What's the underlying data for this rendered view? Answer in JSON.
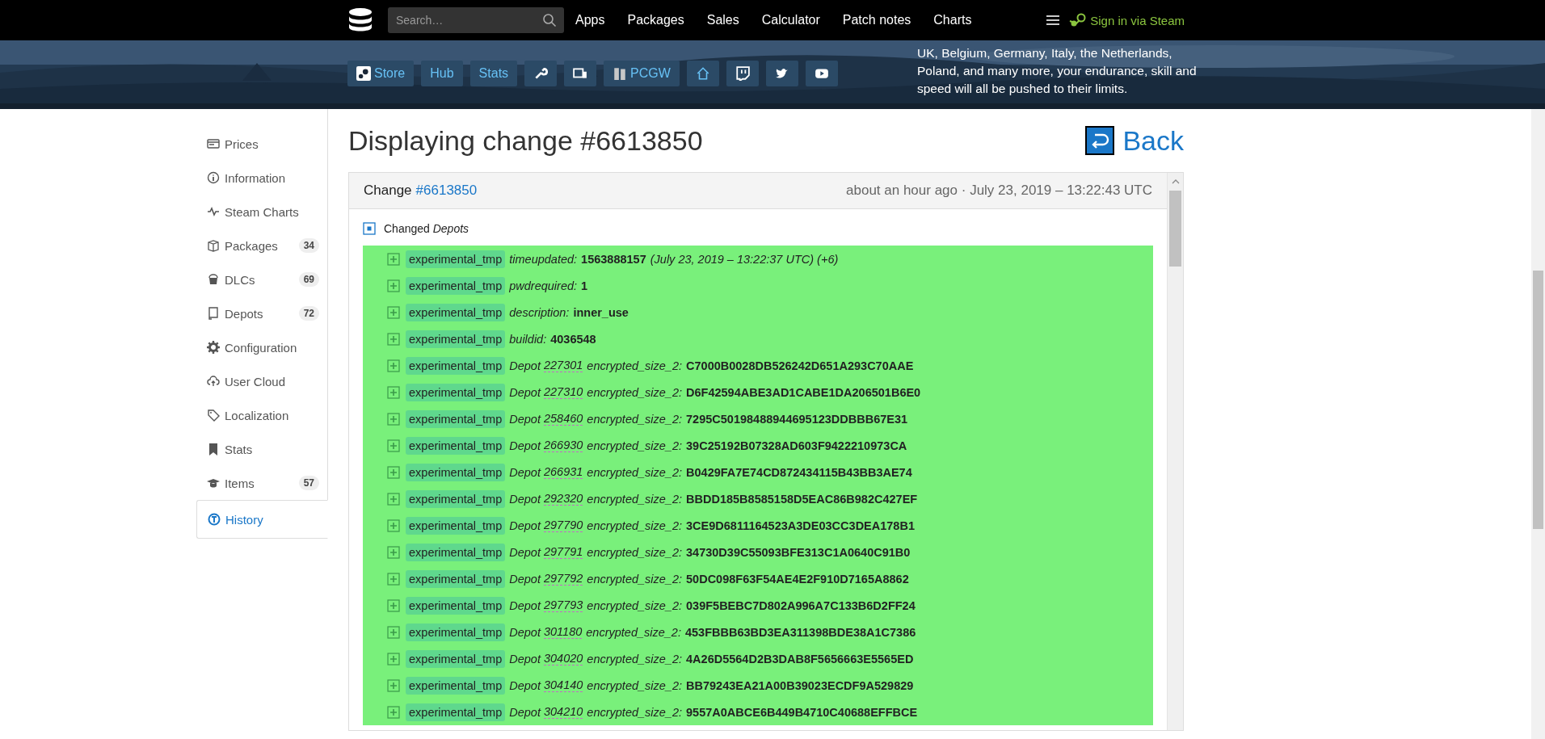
{
  "topbar": {
    "search": {
      "placeholder": "Search…"
    },
    "nav": [
      "Apps",
      "Packages",
      "Sales",
      "Calculator",
      "Patch notes",
      "Charts"
    ],
    "sign_in": "Sign in via Steam"
  },
  "hero": {
    "buttons": [
      {
        "kind": "steam",
        "label": "Store"
      },
      {
        "kind": "text",
        "label": "Hub"
      },
      {
        "kind": "text",
        "label": "Stats"
      },
      {
        "kind": "wrench"
      },
      {
        "kind": "monitor"
      },
      {
        "kind": "pcgw",
        "label": "PCGW"
      },
      {
        "kind": "home"
      },
      {
        "kind": "twitch"
      },
      {
        "kind": "twitter"
      },
      {
        "kind": "youtube"
      }
    ],
    "description": "UK, Belgium, Germany, Italy, the Netherlands, Poland, and many more, your endurance, skill and speed will all be pushed to their limits."
  },
  "sidebar": {
    "items": [
      {
        "label": "Prices",
        "selected": false
      },
      {
        "label": "Information",
        "selected": false
      },
      {
        "label": "Steam Charts",
        "selected": false
      },
      {
        "label": "Packages",
        "badge": "34",
        "selected": false
      },
      {
        "label": "DLCs",
        "badge": "69",
        "selected": false
      },
      {
        "label": "Depots",
        "badge": "72",
        "selected": false
      },
      {
        "label": "Configuration",
        "selected": false
      },
      {
        "label": "User Cloud",
        "selected": false
      },
      {
        "label": "Localization",
        "selected": false
      },
      {
        "label": "Stats",
        "selected": false
      },
      {
        "label": "Items",
        "badge": "57",
        "selected": false
      },
      {
        "label": "History",
        "selected": true
      }
    ]
  },
  "title": "Displaying change #6613850",
  "back": "Back",
  "change": {
    "label": "Change",
    "link": "#6613850",
    "time": "about an hour ago · July 23, 2019 – 13:22:43 UTC",
    "section": {
      "text": "Changed",
      "target": "Depots"
    },
    "rows": [
      {
        "kind": "plain",
        "tag": "experimental_tmp",
        "key": "timeupdated:",
        "value": "1563888157",
        "note": "(July 23, 2019 – 13:22:37 UTC) (+6)"
      },
      {
        "kind": "plain",
        "tag": "experimental_tmp",
        "key": "pwdrequired:",
        "value": "1"
      },
      {
        "kind": "plain",
        "tag": "experimental_tmp",
        "key": "description:",
        "value": "inner_use"
      },
      {
        "kind": "plain",
        "tag": "experimental_tmp",
        "key": "buildid:",
        "value": "4036548"
      },
      {
        "kind": "depot",
        "tag": "experimental_tmp",
        "depot_label": "Depot",
        "depot": "227301",
        "key": "encrypted_size_2:",
        "value": "C7000B0028DB526242D651A293C70AAE"
      },
      {
        "kind": "depot",
        "tag": "experimental_tmp",
        "depot_label": "Depot",
        "depot": "227310",
        "key": "encrypted_size_2:",
        "value": "D6F42594ABE3AD1CABE1DA206501B6E0"
      },
      {
        "kind": "depot",
        "tag": "experimental_tmp",
        "depot_label": "Depot",
        "depot": "258460",
        "key": "encrypted_size_2:",
        "value": "7295C50198488944695123DDBBB67E31"
      },
      {
        "kind": "depot",
        "tag": "experimental_tmp",
        "depot_label": "Depot",
        "depot": "266930",
        "key": "encrypted_size_2:",
        "value": "39C25192B07328AD603F9422210973CA"
      },
      {
        "kind": "depot",
        "tag": "experimental_tmp",
        "depot_label": "Depot",
        "depot": "266931",
        "key": "encrypted_size_2:",
        "value": "B0429FA7E74CD872434115B43BB3AE74"
      },
      {
        "kind": "depot",
        "tag": "experimental_tmp",
        "depot_label": "Depot",
        "depot": "292320",
        "key": "encrypted_size_2:",
        "value": "BBDD185B8585158D5EAC86B982C427EF"
      },
      {
        "kind": "depot",
        "tag": "experimental_tmp",
        "depot_label": "Depot",
        "depot": "297790",
        "key": "encrypted_size_2:",
        "value": "3CE9D6811164523A3DE03CC3DEA178B1"
      },
      {
        "kind": "depot",
        "tag": "experimental_tmp",
        "depot_label": "Depot",
        "depot": "297791",
        "key": "encrypted_size_2:",
        "value": "34730D39C55093BFE313C1A0640C91B0"
      },
      {
        "kind": "depot",
        "tag": "experimental_tmp",
        "depot_label": "Depot",
        "depot": "297792",
        "key": "encrypted_size_2:",
        "value": "50DC098F63F54AE4E2F910D7165A8862"
      },
      {
        "kind": "depot",
        "tag": "experimental_tmp",
        "depot_label": "Depot",
        "depot": "297793",
        "key": "encrypted_size_2:",
        "value": "039F5BEBC7D802A996A7C133B6D2FF24"
      },
      {
        "kind": "depot",
        "tag": "experimental_tmp",
        "depot_label": "Depot",
        "depot": "301180",
        "key": "encrypted_size_2:",
        "value": "453FBBB63BD3EA311398BDE38A1C7386"
      },
      {
        "kind": "depot",
        "tag": "experimental_tmp",
        "depot_label": "Depot",
        "depot": "304020",
        "key": "encrypted_size_2:",
        "value": "4A26D5564D2B3DAB8F5656663E5565ED"
      },
      {
        "kind": "depot",
        "tag": "experimental_tmp",
        "depot_label": "Depot",
        "depot": "304140",
        "key": "encrypted_size_2:",
        "value": "BB79243EA21A00B39023ECDF9A529829"
      },
      {
        "kind": "depot",
        "tag": "experimental_tmp",
        "depot_label": "Depot",
        "depot": "304210",
        "key": "encrypted_size_2:",
        "value": "9557A0ABCE6B449B4710C40688EFFBCE"
      }
    ]
  }
}
